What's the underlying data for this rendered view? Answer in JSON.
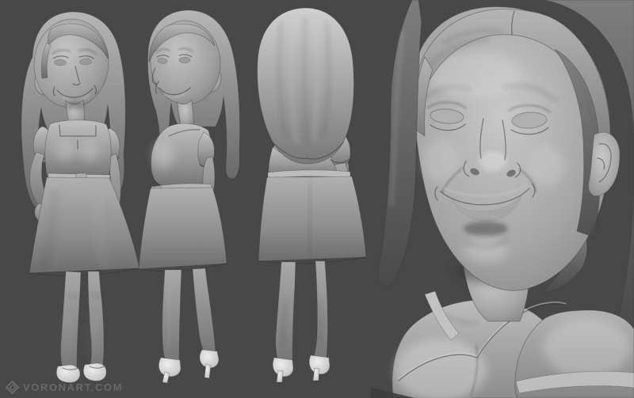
{
  "watermark": {
    "text": "VORONART.COM",
    "logo_icon": "voronart-diamond-spiral-logo"
  },
  "scene": {
    "subject": "grayscale clay sculpt of a stylized bobblehead woman figurine in a short dress",
    "views": [
      {
        "id": "front-three-quarter",
        "label": "Front three-quarter full-body view, hands at hips, flat shoes"
      },
      {
        "id": "side-three-quarter",
        "label": "Side three-quarter full-body view, high heels"
      },
      {
        "id": "back",
        "label": "Back full-body view, long hair, high heels"
      },
      {
        "id": "closeup",
        "label": "Head and bust close-up view, smiling face, blank sculpted eyes"
      }
    ]
  },
  "colors": {
    "background": "#484848",
    "clay_highlight": "#c9c9c9",
    "clay_mid": "#9c9c9c",
    "clay_shadow": "#5a5a5a",
    "hair_dark": "#4e4e4e",
    "outline": "#2e2e2e",
    "watermark": "#6e6e6e"
  }
}
